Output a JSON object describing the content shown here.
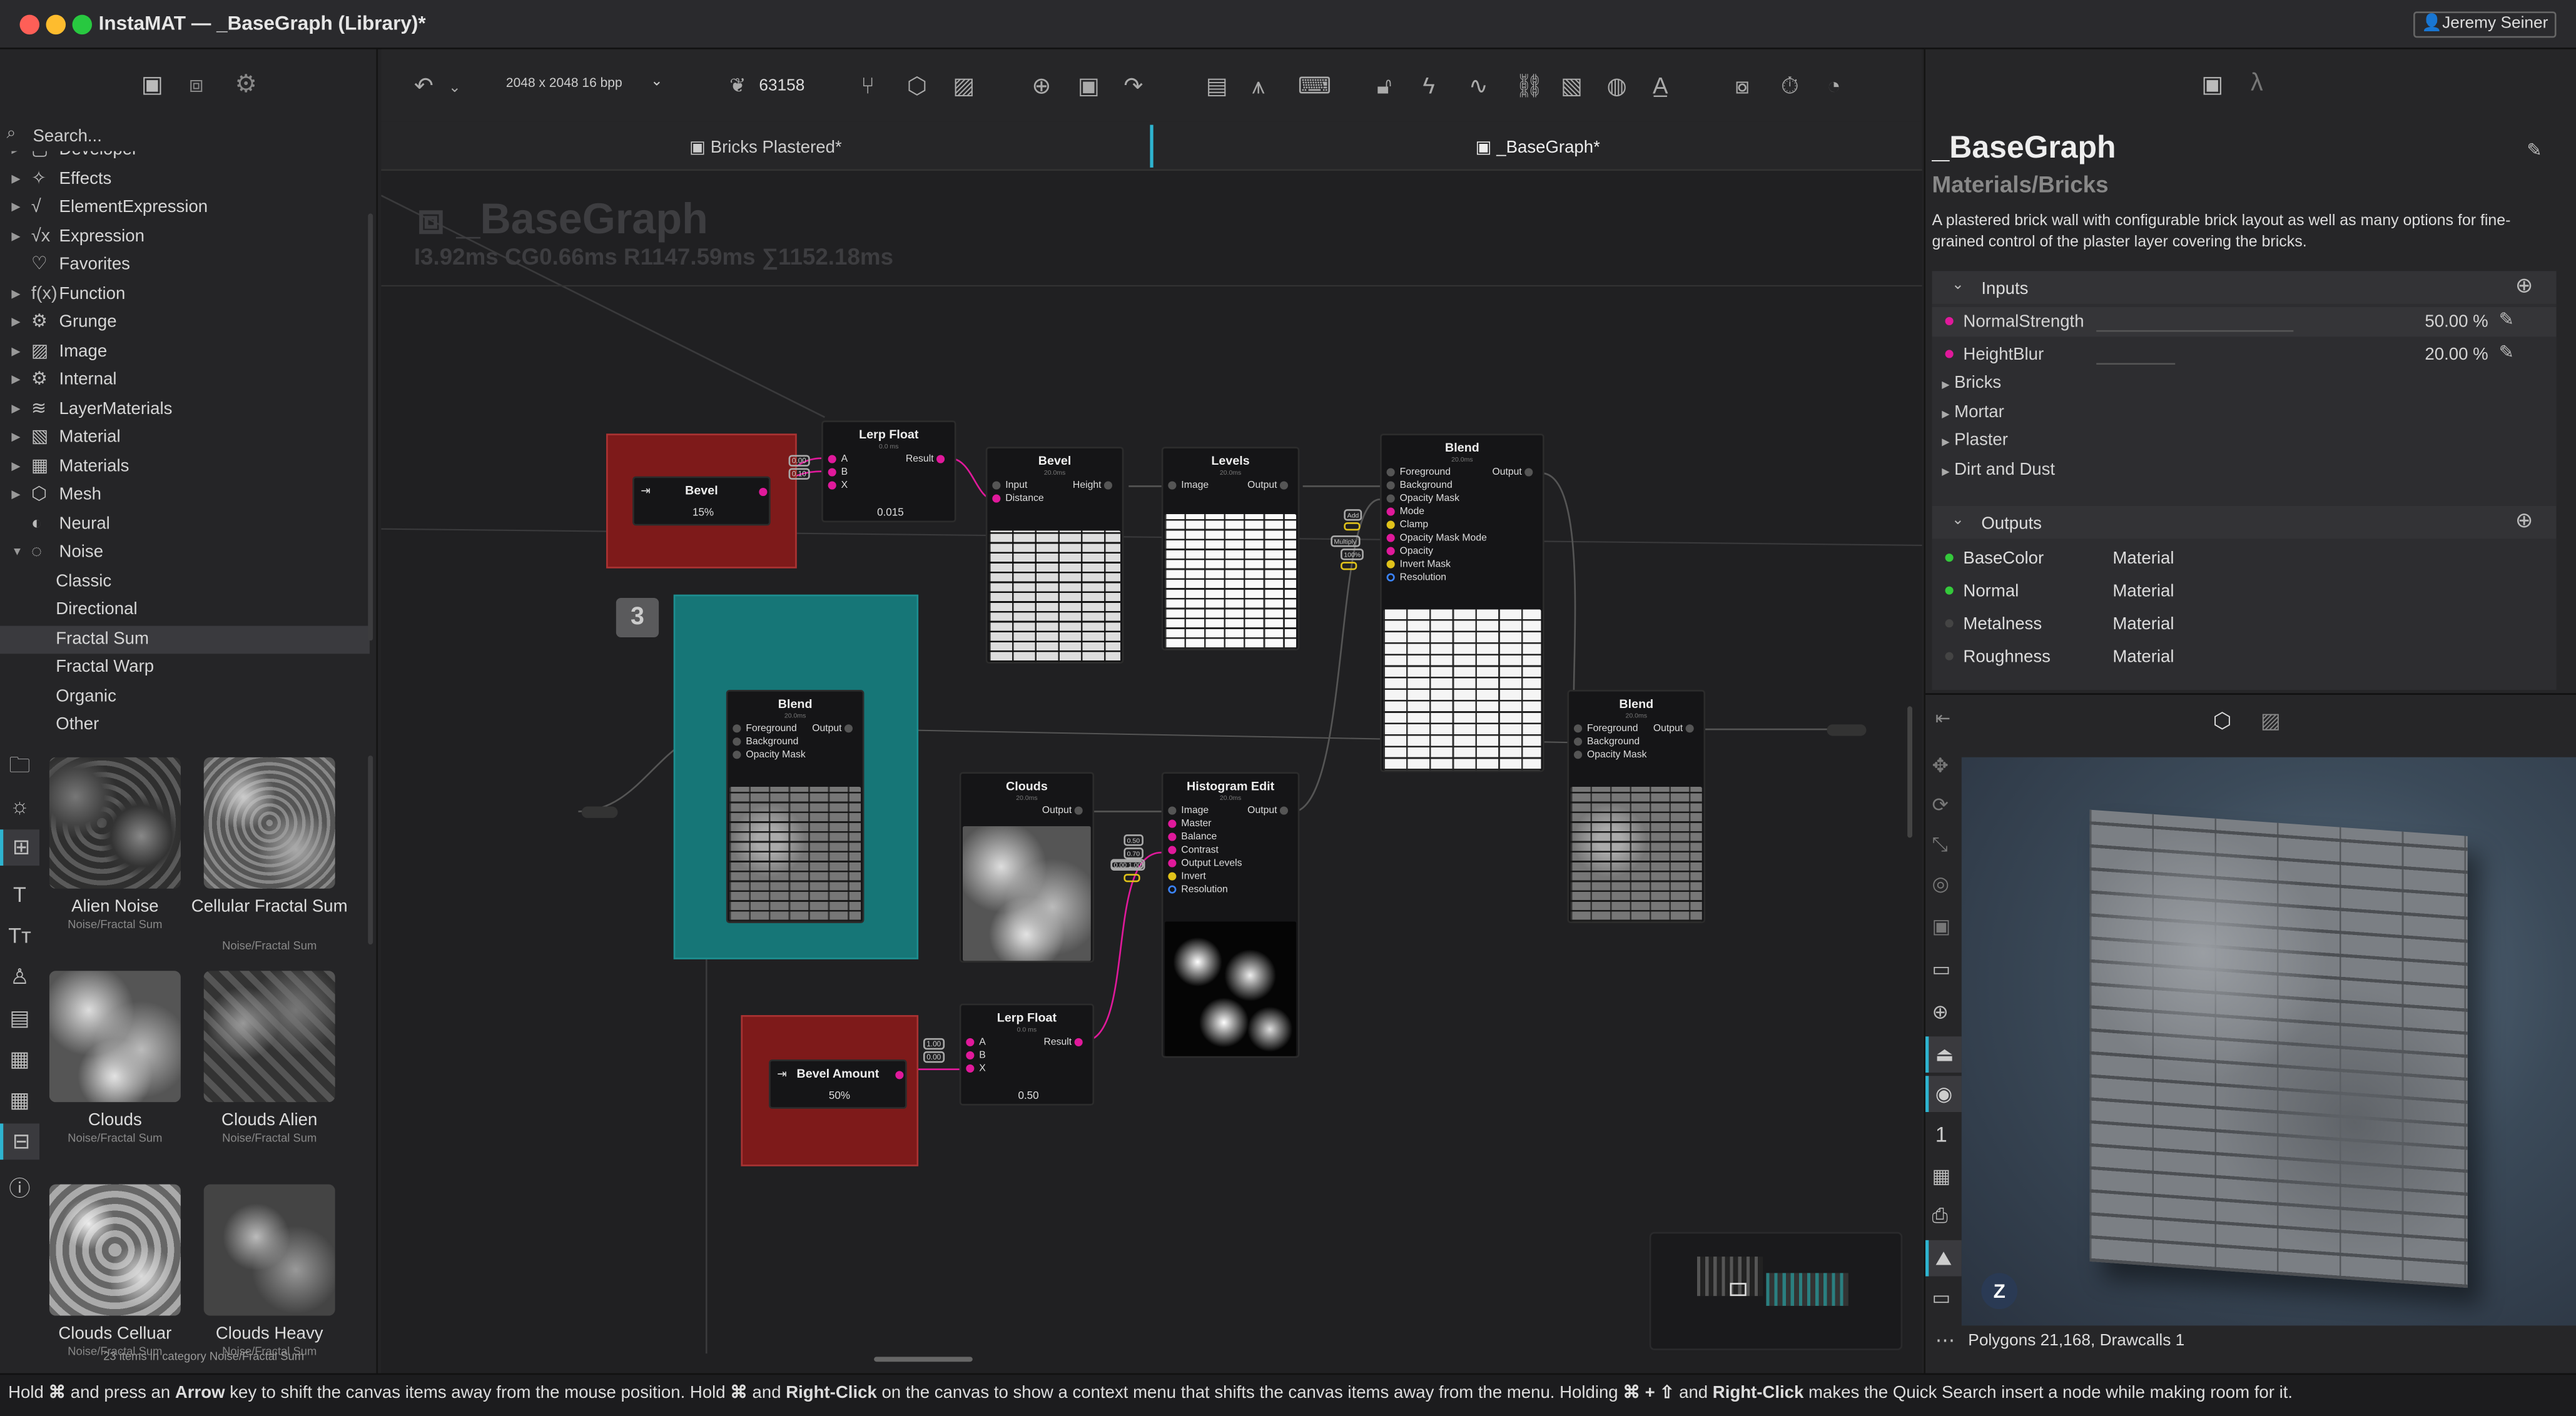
{
  "window": {
    "title": "InstaMAT — _BaseGraph (Library)*",
    "user": "Jeremy Seiner"
  },
  "left": {
    "search_placeholder": "Search...",
    "tree": [
      {
        "label": "Developer",
        "icon": "folder-icon"
      },
      {
        "label": "Effects",
        "icon": "sparkle-icon"
      },
      {
        "label": "ElementExpression",
        "icon": "sqrt-icon"
      },
      {
        "label": "Expression",
        "icon": "sqrt-x-icon"
      },
      {
        "label": "Favorites",
        "icon": "heart-icon"
      },
      {
        "label": "Function",
        "icon": "function-icon"
      },
      {
        "label": "Grunge",
        "icon": "gear-icon"
      },
      {
        "label": "Image",
        "icon": "image-icon"
      },
      {
        "label": "Internal",
        "icon": "cog-icon"
      },
      {
        "label": "LayerMaterials",
        "icon": "layers-icon"
      },
      {
        "label": "Material",
        "icon": "material-icon"
      },
      {
        "label": "Materials",
        "icon": "materials-icon"
      },
      {
        "label": "Mesh",
        "icon": "cube-icon"
      },
      {
        "label": "Neural",
        "icon": "neural-icon"
      },
      {
        "label": "Noise",
        "icon": "noise-icon"
      }
    ],
    "noise_children": [
      "Classic",
      "Directional",
      "Fractal Sum",
      "Fractal Warp",
      "Organic",
      "Other"
    ],
    "selected": "Fractal Sum",
    "thumbs": [
      {
        "name": "Alien Noise",
        "sub": "Noise/Fractal Sum"
      },
      {
        "name": "Cellular Fractal Sum",
        "sub": "Noise/Fractal Sum"
      },
      {
        "name": "Clouds",
        "sub": "Noise/Fractal Sum"
      },
      {
        "name": "Clouds Alien",
        "sub": "Noise/Fractal Sum"
      },
      {
        "name": "Clouds Celluar",
        "sub": "Noise/Fractal Sum"
      },
      {
        "name": "Clouds Heavy",
        "sub": "Noise/Fractal Sum"
      }
    ],
    "footer": "23 items in category Noise/Fractal Sum"
  },
  "toolbar": {
    "resolution": "2048 x 2048 16 bpp",
    "seed": "63158"
  },
  "tabs": [
    "Bricks Plastered*",
    "_BaseGraph*"
  ],
  "canvas": {
    "graph_title": "_BaseGraph",
    "timing": "I3.92ms CG0.66ms R1147.59ms ∑1152.18ms",
    "frame_number": "3",
    "nodes": {
      "bevel_input": {
        "title": "Bevel",
        "value": "15%"
      },
      "lerp1": {
        "title": "Lerp Float",
        "pins": [
          "A",
          "B",
          "X"
        ],
        "out": "Result",
        "value": "0.015",
        "inA": "0.00",
        "inB": "0.10"
      },
      "bevel": {
        "title": "Bevel",
        "pins": [
          "Input",
          "Distance"
        ],
        "out": "Height"
      },
      "levels": {
        "title": "Levels",
        "pins": [
          "Image"
        ],
        "out": "Output"
      },
      "blend_top": {
        "title": "Blend",
        "pins": [
          "Foreground",
          "Background",
          "Opacity Mask",
          "Mode",
          "Clamp",
          "Opacity Mask Mode",
          "Opacity",
          "Invert Mask",
          "Resolution"
        ],
        "out": "Output",
        "badges": [
          "Add",
          "",
          "Multiply",
          "100%",
          ""
        ]
      },
      "blend_mid": {
        "title": "Blend",
        "pins": [
          "Foreground",
          "Background",
          "Opacity Mask"
        ],
        "out": "Output"
      },
      "clouds": {
        "title": "Clouds",
        "out": "Output"
      },
      "histogram": {
        "title": "Histogram Edit",
        "pins": [
          "Image",
          "Master",
          "Balance",
          "Contrast",
          "Output Levels",
          "Invert",
          "Resolution"
        ],
        "out": "Output",
        "badges": [
          "0.50",
          "0.70",
          "",
          "0.00 1.00",
          ""
        ]
      },
      "blend_right": {
        "title": "Blend",
        "pins": [
          "Foreground",
          "Background",
          "Opacity Mask"
        ],
        "out": "Output"
      },
      "bevel_amount": {
        "title": "Bevel Amount",
        "value": "50%"
      },
      "lerp2": {
        "title": "Lerp Float",
        "pins": [
          "A",
          "B",
          "X"
        ],
        "out": "Result",
        "value": "0.50",
        "inA": "1.00",
        "inB": "0.00"
      }
    }
  },
  "right": {
    "title": "_BaseGraph",
    "category": "Materials/Bricks",
    "description": "A plastered brick wall with configurable brick layout as well as many options for fine-grained control of the plaster layer covering the bricks.",
    "inputs_label": "Inputs",
    "inputs": [
      {
        "name": "NormalStrength",
        "value": "50.00 %"
      },
      {
        "name": "HeightBlur",
        "value": "20.00 %"
      }
    ],
    "groups": [
      "Bricks",
      "Mortar",
      "Plaster",
      "Dirt and Dust"
    ],
    "outputs_label": "Outputs",
    "outputs": [
      {
        "name": "BaseColor",
        "type": "Material",
        "active": true
      },
      {
        "name": "Normal",
        "type": "Material",
        "active": true
      },
      {
        "name": "Metalness",
        "type": "Material",
        "active": false
      },
      {
        "name": "Roughness",
        "type": "Material",
        "active": false
      }
    ],
    "viewport_status": "Polygons 21,168, Drawcalls 1",
    "viewport_counter": "1"
  },
  "status": {
    "hint_html_parts": [
      "Hold ",
      "⌘",
      " and press an ",
      "Arrow",
      " key to shift the canvas items away from the mouse position. Hold ",
      "⌘",
      " and ",
      "Right-Click",
      " on the canvas to show a context menu that shifts the canvas items away from the menu. Holding ",
      "⌘ + ⇧",
      " and ",
      "Right-Click",
      " makes the Quick Search insert a node while making room for it."
    ]
  }
}
